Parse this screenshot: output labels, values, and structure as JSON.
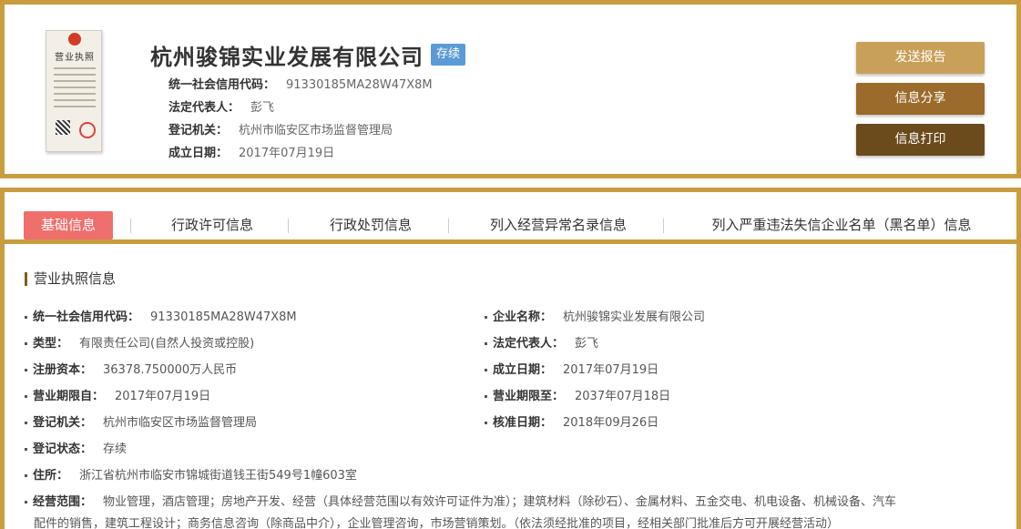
{
  "header": {
    "license_title": "营业执照",
    "company_name": "杭州骏锦实业发展有限公司",
    "status": "存续",
    "credit_code_label": "统一社会信用代码：",
    "credit_code": "91330185MA28W47X8M",
    "legal_rep_label": "法定代表人：",
    "legal_rep": "彭飞",
    "authority_label": "登记机关：",
    "authority": "杭州市临安区市场监督管理局",
    "founded_label": "成立日期：",
    "founded": "2017年07月19日"
  },
  "actions": {
    "send_report": "发送报告",
    "share_info": "信息分享",
    "print_info": "信息打印"
  },
  "tabs": [
    {
      "label": "基础信息",
      "active": true
    },
    {
      "label": "行政许可信息",
      "active": false
    },
    {
      "label": "行政处罚信息",
      "active": false
    },
    {
      "label": "列入经营异常名录信息",
      "active": false
    },
    {
      "label": "列入严重违法失信企业名单（黑名单）信息",
      "active": false
    }
  ],
  "section": {
    "title": "营业执照信息",
    "fields": {
      "credit_code": {
        "label": "统一社会信用代码：",
        "value": "91330185MA28W47X8M"
      },
      "company_name": {
        "label": "企业名称：",
        "value": "杭州骏锦实业发展有限公司"
      },
      "type": {
        "label": "类型：",
        "value": "有限责任公司(自然人投资或控股)"
      },
      "legal_rep": {
        "label": "法定代表人：",
        "value": "彭飞"
      },
      "capital": {
        "label": "注册资本：",
        "value": "36378.750000万人民币"
      },
      "founded": {
        "label": "成立日期：",
        "value": "2017年07月19日"
      },
      "term_from": {
        "label": "营业期限自：",
        "value": "2017年07月19日"
      },
      "term_to": {
        "label": "营业期限至：",
        "value": "2037年07月18日"
      },
      "authority": {
        "label": "登记机关：",
        "value": "杭州市临安区市场监督管理局"
      },
      "approved": {
        "label": "核准日期：",
        "value": "2018年09月26日"
      },
      "reg_status": {
        "label": "登记状态：",
        "value": "存续"
      },
      "address": {
        "label": "住所：",
        "value": "浙江省杭州市临安市锦城街道钱王街549号1幢603室"
      },
      "scope": {
        "label": "经营范围：",
        "value_line1": "物业管理，酒店管理；房地产开发、经营（具体经营范围以有效许可证件为准）；建筑材料（除砂石）、金属材料、五金交电、机电设备、机械设备、汽车",
        "value_line2": "配件的销售，建筑工程设计；商务信息咨询（除商品中介），企业管理咨询，市场营销策划。（依法须经批准的项目，经相关部门批准后方可开展经营活动）"
      }
    }
  },
  "colors": {
    "gold_border": "#c99d3f",
    "active_tab": "#ef6f6c",
    "badge": "#5b9bd5"
  }
}
